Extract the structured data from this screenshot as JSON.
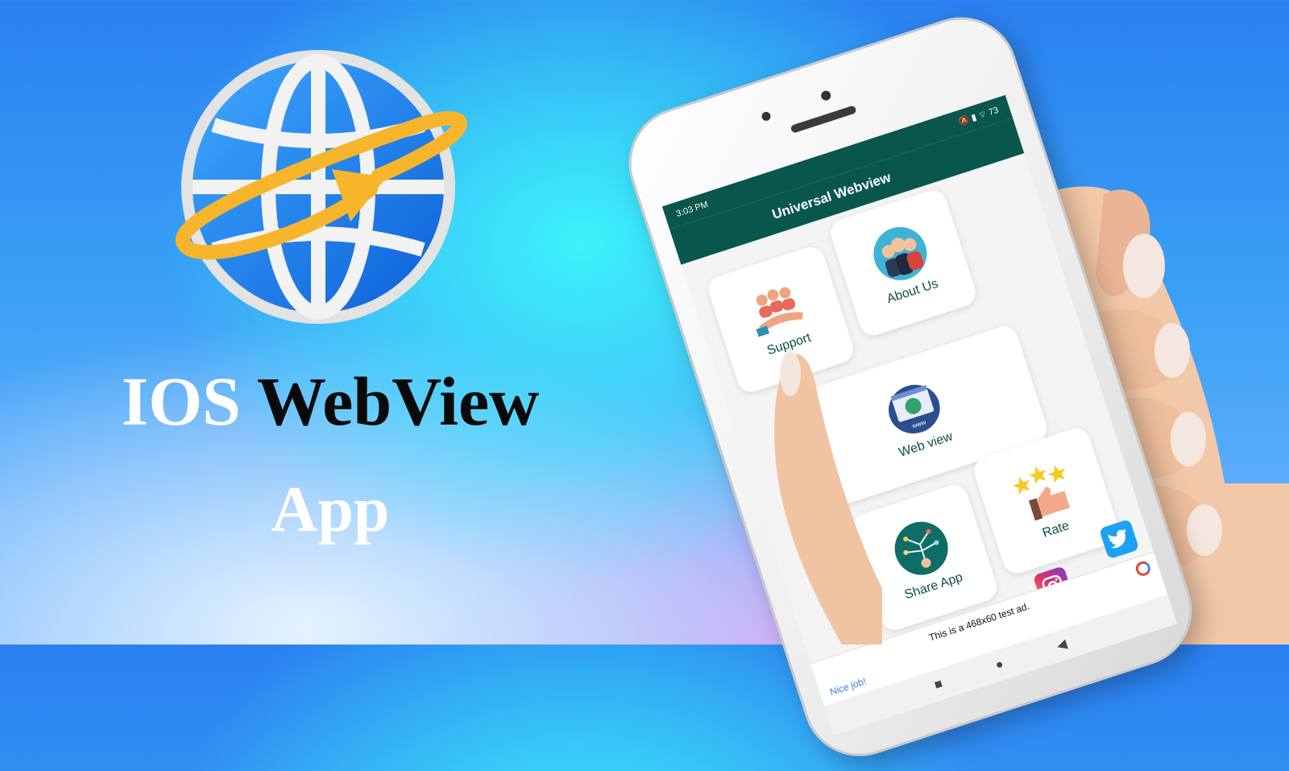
{
  "headline": {
    "word1": "IOS",
    "word2": "WebView",
    "line2": "App"
  },
  "phone": {
    "status_time": "3:03 PM",
    "status_icons": "🔕 ▮ ⌔ 73",
    "app_title": "Universal Webview",
    "cards": {
      "support": "Support",
      "about": "About Us",
      "webview": "Web view",
      "share": "Share App",
      "rate": "Rate"
    },
    "social": {
      "twitter_icon": "twitter-icon",
      "instagram_icon": "instagram-icon",
      "facebook_icon": "facebook-icon"
    },
    "ad": {
      "nice": "Nice job!",
      "text": "This is a 468x60 test ad."
    },
    "nav": {
      "back": "◀",
      "home": "●",
      "recent": "■"
    }
  },
  "colors": {
    "accent": "#08564c",
    "globe_blue": "#1f7ff0",
    "orbit": "#f6b52b"
  }
}
